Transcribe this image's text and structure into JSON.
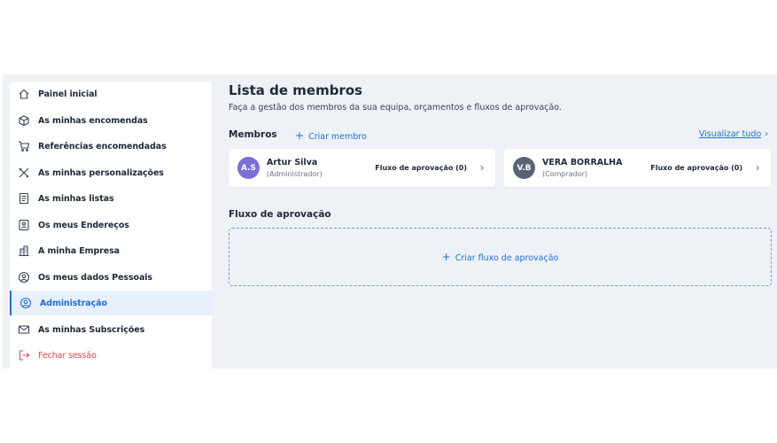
{
  "sidebar": {
    "items": [
      {
        "label": "Painel inicial",
        "icon": "home-icon"
      },
      {
        "label": "As minhas encomendas",
        "icon": "box-icon"
      },
      {
        "label": "Referências encomendadas",
        "icon": "cart-icon"
      },
      {
        "label": "As minhas personalizações",
        "icon": "tools-icon"
      },
      {
        "label": "As minhas listas",
        "icon": "list-icon"
      },
      {
        "label": "Os meus Endereços",
        "icon": "address-icon"
      },
      {
        "label": "A minha Empresa",
        "icon": "building-icon"
      },
      {
        "label": "Os meus dados Pessoais",
        "icon": "user-icon"
      },
      {
        "label": "Administração",
        "icon": "admin-icon",
        "active": true
      },
      {
        "label": "As minhas Subscrições",
        "icon": "mail-icon"
      },
      {
        "label": "Fechar sessão",
        "icon": "logout-icon"
      }
    ]
  },
  "main": {
    "title": "Lista de membros",
    "subtitle": "Faça a gestão dos membros da sua equipa, orçamentos e fluxos de aprovação.",
    "members_heading": "Membros",
    "create_member_label": "Criar membro",
    "view_all_label": "Visualizar tudo",
    "members": [
      {
        "initials": "A.S",
        "name": "Artur Silva",
        "role": "(Administrador)",
        "flow": "Fluxo de aprovação (0)",
        "avatar_color": "#7c6fdc"
      },
      {
        "initials": "V.B",
        "name": "VERA BORRALHA",
        "role": "(Comprador)",
        "flow": "Fluxo de aprovação (0)",
        "avatar_color": "#5a6372"
      }
    ],
    "flow_heading": "Fluxo de aprovação",
    "create_flow_label": "Criar fluxo de aprovação"
  },
  "colors": {
    "accent": "#1f6fd6",
    "logout": "#e04848",
    "background": "#eef2f7"
  }
}
